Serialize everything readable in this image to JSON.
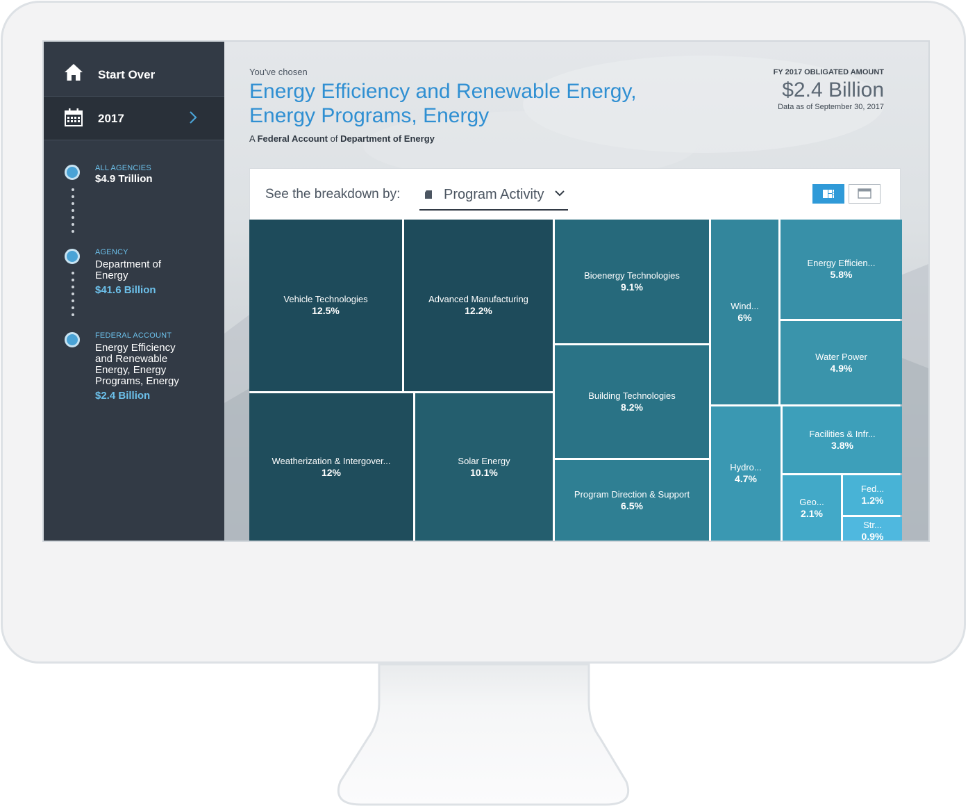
{
  "sidebar": {
    "start_over": "Start Over",
    "year": "2017",
    "steps": [
      {
        "label": "ALL AGENCIES",
        "name": "",
        "amount": "$4.9 Trillion"
      },
      {
        "label": "AGENCY",
        "name": "Department of Energy",
        "amount": "$41.6 Billion"
      },
      {
        "label": "FEDERAL ACCOUNT",
        "name": "Energy Efficiency and Renewable Energy, Energy Programs, Energy",
        "amount": "$2.4 Billion"
      }
    ]
  },
  "header": {
    "chosen": "You've chosen",
    "title": "Energy Efficiency and Renewable Energy, Energy Programs, Energy",
    "sub_prefix": "A",
    "sub_type": "Federal Account",
    "sub_of": "of",
    "sub_agency": "Department of Energy"
  },
  "summary": {
    "label": "FY 2017 OBLIGATED AMOUNT",
    "amount": "$2.4 Billion",
    "as_of": "Data as of September 30, 2017"
  },
  "breakdown": {
    "label": "See the breakdown by:",
    "selected": "Program Activity"
  },
  "colors": {
    "sidebar": "#323a45",
    "accent": "#2f9ad8",
    "title": "#2f8fd2",
    "tile_darkest": "#1e4b5b",
    "tile_lightest": "#4fb8df"
  },
  "treemap": [
    {
      "name": "Vehicle Technologies",
      "pct": "12.5%"
    },
    {
      "name": "Advanced Manufacturing",
      "pct": "12.2%"
    },
    {
      "name": "Weatherization & Intergover...",
      "pct": "12%"
    },
    {
      "name": "Solar Energy",
      "pct": "10.1%"
    },
    {
      "name": "Bioenergy Technologies",
      "pct": "9.1%"
    },
    {
      "name": "Building Technologies",
      "pct": "8.2%"
    },
    {
      "name": "Program Direction & Support",
      "pct": "6.5%"
    },
    {
      "name": "Wind...",
      "pct": "6%"
    },
    {
      "name": "Energy Efficien...",
      "pct": "5.8%"
    },
    {
      "name": "Water Power",
      "pct": "4.9%"
    },
    {
      "name": "Hydro...",
      "pct": "4.7%"
    },
    {
      "name": "Facilities & Infr...",
      "pct": "3.8%"
    },
    {
      "name": "Geo...",
      "pct": "2.1%"
    },
    {
      "name": "Fed...",
      "pct": "1.2%"
    },
    {
      "name": "Str...",
      "pct": "0.9%"
    }
  ]
}
